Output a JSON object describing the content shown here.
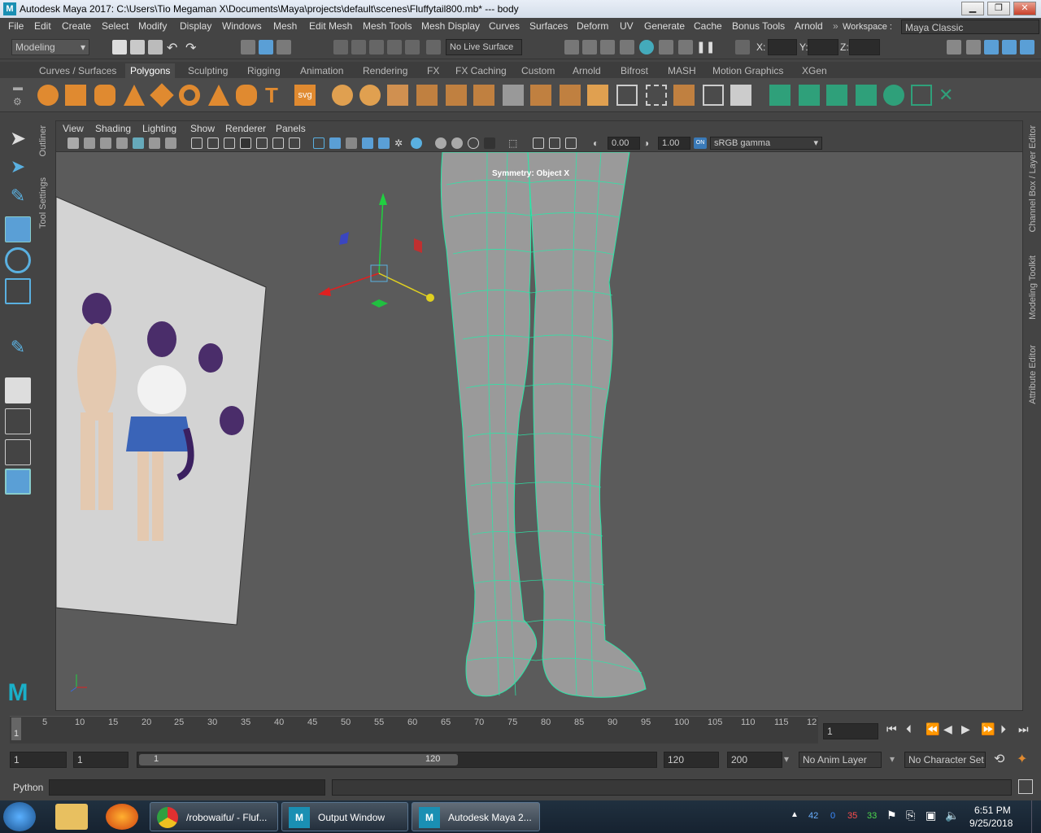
{
  "window": {
    "title": "Autodesk Maya 2017: C:\\Users\\Tio Megaman X\\Documents\\Maya\\projects\\default\\scenes\\Fluffytail800.mb*   ---   body",
    "app_icon": "M"
  },
  "menubar": {
    "items": [
      "File",
      "Edit",
      "Create",
      "Select",
      "Modify",
      "Display",
      "Windows",
      "Mesh",
      "Edit Mesh",
      "Mesh Tools",
      "Mesh Display",
      "Curves",
      "Surfaces",
      "Deform",
      "UV",
      "Generate",
      "Cache",
      "Bonus Tools",
      "Arnold"
    ],
    "workspace_label": "Workspace :",
    "workspace_value": "Maya Classic"
  },
  "statusline": {
    "mode": "Modeling",
    "live_surface": "No Live Surface",
    "x_label": "X:",
    "y_label": "Y:",
    "z_label": "Z:"
  },
  "shelf": {
    "tabs": [
      "Curves / Surfaces",
      "Polygons",
      "Sculpting",
      "Rigging",
      "Animation",
      "Rendering",
      "FX",
      "FX Caching",
      "Custom",
      "Arnold",
      "Bifrost",
      "MASH",
      "Motion Graphics",
      "XGen"
    ],
    "active_tab": "Polygons",
    "text_icon": "T",
    "svg_icon": "svg"
  },
  "side_tabs": {
    "outliner": "Outliner",
    "tool_settings": "Tool Settings",
    "channel_box": "Channel Box / Layer Editor",
    "modeling_toolkit": "Modeling Toolkit",
    "attribute_editor": "Attribute Editor"
  },
  "panel": {
    "menu": [
      "View",
      "Shading",
      "Lighting",
      "Show",
      "Renderer",
      "Panels"
    ],
    "exposure": "0.00",
    "gamma": "1.00",
    "colorspace": "sRGB gamma",
    "symmetry": "Symmetry: Object X"
  },
  "timeline": {
    "ticks": [
      "5",
      "10",
      "15",
      "20",
      "25",
      "30",
      "35",
      "40",
      "45",
      "50",
      "55",
      "60",
      "65",
      "70",
      "75",
      "80",
      "85",
      "90",
      "95",
      "100",
      "105",
      "110",
      "115",
      "12"
    ],
    "start_tick": "1",
    "current_frame": "1"
  },
  "range": {
    "start": "1",
    "playback_start": "1",
    "slider_start": "1",
    "slider_end": "120",
    "playback_end": "120",
    "end": "200",
    "anim_layer": "No Anim Layer",
    "char_set": "No Character Set"
  },
  "cmdline": {
    "lang": "Python"
  },
  "taskbar": {
    "tasks": [
      "/robowaifu/ - Fluf...",
      "Output Window",
      "Autodesk Maya 2..."
    ],
    "tray_numbers": [
      "42",
      "0",
      "35",
      "33"
    ],
    "tray_colors": [
      "#6ab0ff",
      "#3b8bff",
      "#ff4d4d",
      "#4dd94d"
    ],
    "time": "6:51 PM",
    "date": "9/25/2018"
  }
}
